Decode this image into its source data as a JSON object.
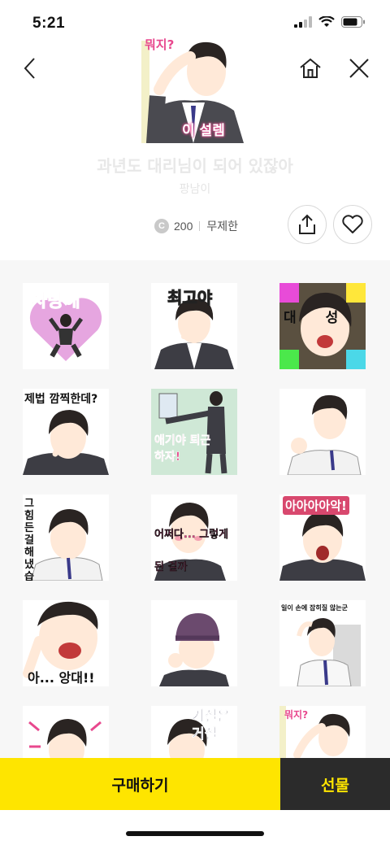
{
  "status_bar": {
    "time": "5:21"
  },
  "header": {
    "hero_texts": [
      "뭐지?",
      "이 설렘"
    ],
    "title": "과년도 대리님이 되어 있잖아",
    "author": "팡남이"
  },
  "price": {
    "coin_symbol": "C",
    "amount": "200",
    "period": "무제한"
  },
  "stickers": [
    {
      "text": "사랑해",
      "color": "#e8486b"
    },
    {
      "text": "최고야",
      "color": "#ffe73a"
    },
    {
      "text": "대성통곡",
      "color": "#111111"
    },
    {
      "text": "제법 깜찍한데?",
      "color": "#111111"
    },
    {
      "text": "애기야 퇴근하자!",
      "color": "#e8488e"
    },
    {
      "text": "",
      "color": ""
    },
    {
      "text": "그 힘든 걸 해냈습니다",
      "color": "#111111"
    },
    {
      "text": "어쩌다... 그렇게 된 걸까",
      "color": "#e8488e"
    },
    {
      "text": "아아아아악!",
      "color": "#ffffff"
    },
    {
      "text": "아... 앙대!!",
      "color": "#111111"
    },
    {
      "text": "",
      "color": ""
    },
    {
      "text": "일이 손에 잡히질 않는군",
      "color": "#111111"
    },
    {
      "text": "",
      "color": ""
    },
    {
      "text": "거절은 거절",
      "color": "#222244"
    },
    {
      "text": "뭐지?",
      "color": "#e8488e"
    }
  ],
  "actions": {
    "buy_label": "구매하기",
    "gift_label": "선물"
  },
  "colors": {
    "accent": "#fee500",
    "gift_bg": "#2b2b2b",
    "grid_bg": "#f7f7f7"
  }
}
